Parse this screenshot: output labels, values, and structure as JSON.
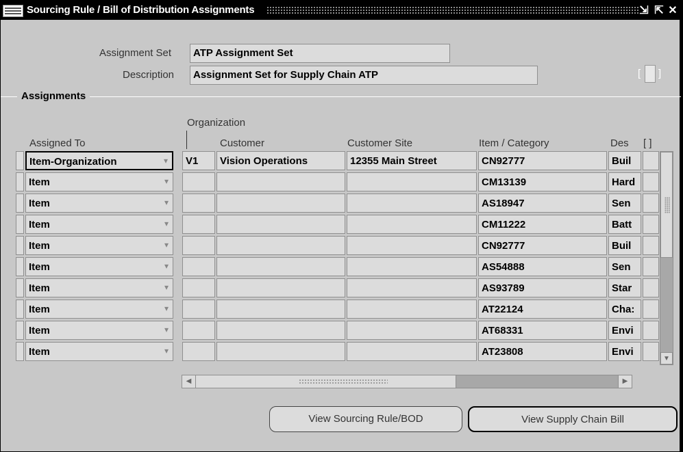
{
  "window": {
    "title": "Sourcing Rule / Bill of Distribution Assignments",
    "controls": [
      "⇲",
      "⇱",
      "✕"
    ]
  },
  "header": {
    "assignment_set_label": "Assignment Set",
    "assignment_set_value": "ATP Assignment Set",
    "description_label": "Description",
    "description_value": "Assignment Set for Supply Chain ATP",
    "bracket_open": "[",
    "bracket_close": "]"
  },
  "assignments": {
    "section_title": "Assignments",
    "group_header": "Organization",
    "columns": {
      "assigned_to": "Assigned To",
      "customer": "Customer",
      "customer_site": "Customer Site",
      "item_category": "Item / Category",
      "description": "Des",
      "extra": "[ ]"
    },
    "rows": [
      {
        "assigned_to": "Item-Organization",
        "org": "V1",
        "customer": "Vision Operations",
        "site": "12355 Main Street",
        "item": "CN92777",
        "desc": "Buil"
      },
      {
        "assigned_to": "Item",
        "org": "",
        "customer": "",
        "site": "",
        "item": "CM13139",
        "desc": "Hard"
      },
      {
        "assigned_to": "Item",
        "org": "",
        "customer": "",
        "site": "",
        "item": "AS18947",
        "desc": "Sen"
      },
      {
        "assigned_to": "Item",
        "org": "",
        "customer": "",
        "site": "",
        "item": "CM11222",
        "desc": "Batt"
      },
      {
        "assigned_to": "Item",
        "org": "",
        "customer": "",
        "site": "",
        "item": "CN92777",
        "desc": "Buil"
      },
      {
        "assigned_to": "Item",
        "org": "",
        "customer": "",
        "site": "",
        "item": "AS54888",
        "desc": "Sen"
      },
      {
        "assigned_to": "Item",
        "org": "",
        "customer": "",
        "site": "",
        "item": "AS93789",
        "desc": "Star"
      },
      {
        "assigned_to": "Item",
        "org": "",
        "customer": "",
        "site": "",
        "item": "AT22124",
        "desc": "Cha:"
      },
      {
        "assigned_to": "Item",
        "org": "",
        "customer": "",
        "site": "",
        "item": "AT68331",
        "desc": "Envi"
      },
      {
        "assigned_to": "Item",
        "org": "",
        "customer": "",
        "site": "",
        "item": "AT23808",
        "desc": "Envi"
      }
    ]
  },
  "buttons": {
    "view_sourcing_rule": "View Sourcing Rule/BOD",
    "view_supply_chain_bill": "View Supply Chain Bill"
  }
}
